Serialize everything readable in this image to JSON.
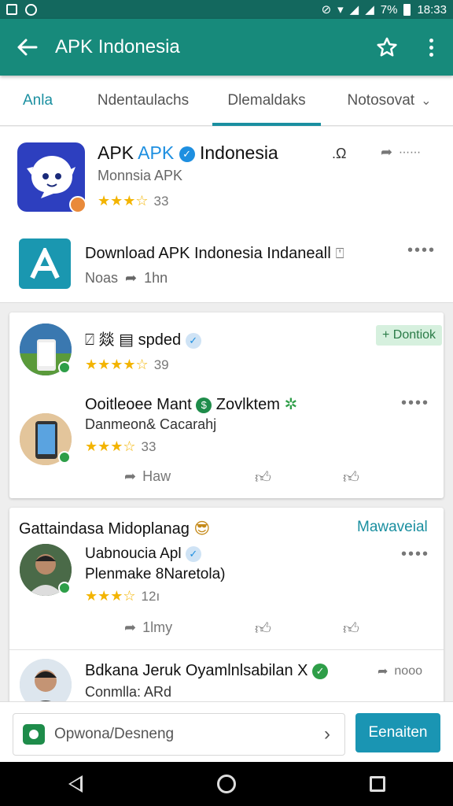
{
  "status": {
    "battery": "7%",
    "time": "18:33"
  },
  "appbar": {
    "title": "APK Indonesia"
  },
  "tabs": [
    {
      "label": "Anla"
    },
    {
      "label": "Ndentaulachs"
    },
    {
      "label": "Dlemaldaks"
    },
    {
      "label": "Notosovat"
    }
  ],
  "featured": {
    "title_prefix": "APK",
    "title_accent": "APK",
    "title_suffix": "Indonesia",
    "title_mark": ".Ω",
    "subtitle": "Monnsia APK",
    "rating": "33",
    "stars": "★★★☆",
    "share_label": "⋯⋯"
  },
  "download_row": {
    "title": "Download APK Indonesia Indanealǀ",
    "sub_left": "Noas",
    "sub_right": "1hn"
  },
  "card1": {
    "item1": {
      "title": "spded",
      "title_symbols": "⍁  燚  ▤",
      "rating": "39",
      "stars": "★★★★☆",
      "button": "Dontiok"
    },
    "item2": {
      "title": "Ooitleoee Mant",
      "title_after": "Zovlktem",
      "subtitle": "Danmeon& Cacarahj",
      "rating": "33",
      "stars": "★★★☆"
    },
    "actions": {
      "share": "Haw"
    }
  },
  "card2": {
    "header": "Gattaindasa Midoplanag",
    "header_link": "Mawaveial",
    "item1": {
      "title": "Uabnoucia Apl",
      "subtitle": "Plenmake 8Naretola)",
      "rating": "12ı",
      "stars": "★★★☆",
      "action_label": "1lmy"
    },
    "item2": {
      "title": "Bdkana Jeruk Oyamlnlsabilan X",
      "subtitle": "Conmlla: ARd",
      "share_label": "nooo"
    }
  },
  "bottom": {
    "search_placeholder": "Opwona/Desneng",
    "button_label": "Eenaiten"
  },
  "colors": {
    "statusbar": "#13685e",
    "appbar": "#178a7b",
    "accent": "#1a8fa0",
    "primary_button": "#1a95b3",
    "star": "#f3b400",
    "verified_green": "#2e9e48"
  }
}
